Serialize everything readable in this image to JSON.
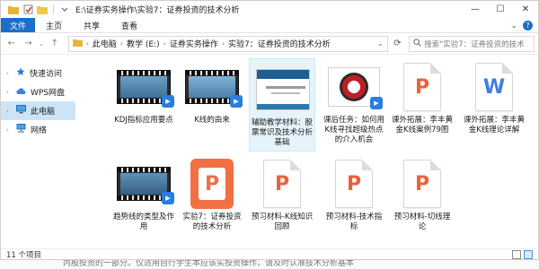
{
  "window": {
    "title": "E:\\证券实务操作\\实验7：证券投资的技术分析",
    "controls": {
      "minimize": "—",
      "maximize": "☐",
      "close": "✕"
    }
  },
  "ribbon": {
    "tabs": [
      "文件",
      "主页",
      "共享",
      "查看"
    ],
    "accent": "#1a6fc9"
  },
  "address": {
    "crumbs": [
      "此电脑",
      "教学 (E:)",
      "证券实务操作",
      "实验7：证券投资的技术分析"
    ],
    "search_placeholder": "搜索\"实验7：证券投资的技术"
  },
  "sidebar": {
    "items": [
      {
        "label": "快速访问",
        "icon": "star-icon"
      },
      {
        "label": "WPS网盘",
        "icon": "cloud-icon"
      },
      {
        "label": "此电脑",
        "icon": "computer-icon",
        "active": true
      },
      {
        "label": "网络",
        "icon": "network-icon"
      }
    ]
  },
  "files": [
    {
      "name": "KDJ指标应用要点",
      "type": "video"
    },
    {
      "name": "K线的由来",
      "type": "video"
    },
    {
      "name": "辅助教学材料：股票常识及技术分析基础",
      "type": "slide",
      "selected": true
    },
    {
      "name": "课后任务：如何用K线寻找超级热点的介入机会",
      "type": "image-red"
    },
    {
      "name": "课外拓展：李丰黄金K线案例79图",
      "type": "pdf"
    },
    {
      "name": "课外拓展：李丰黄金K线理论详解",
      "type": "word"
    },
    {
      "name": "趋势线的类型及作用",
      "type": "video"
    },
    {
      "name": "实验7：证券投资的技术分析",
      "type": "ppt"
    },
    {
      "name": "预习材料-K线知识回顾",
      "type": "ppt"
    },
    {
      "name": "预习材料-技术指标",
      "type": "ppt"
    },
    {
      "name": "预习材料-切线理论",
      "type": "ppt"
    }
  ],
  "status": {
    "count": "11 个项目"
  },
  "background_text": "内股投资的一部分。仅适用自行学生本应该实投资操作，请及时认准技术分析基本"
}
